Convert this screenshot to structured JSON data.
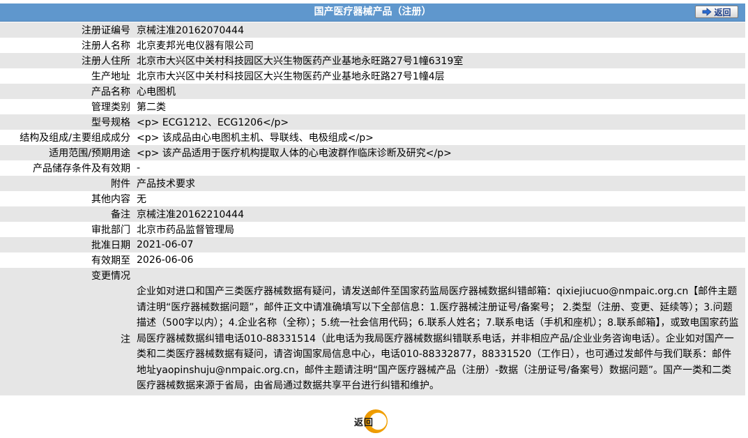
{
  "header": {
    "title": "国产医疗器械产品（注册）",
    "back_label": "返回"
  },
  "fields": [
    {
      "label": "注册证编号",
      "value": "京械注准20162070444"
    },
    {
      "label": "注册人名称",
      "value": "北京麦邦光电仪器有限公司"
    },
    {
      "label": "注册人住所",
      "value": "北京市大兴区中关村科技园区大兴生物医药产业基地永旺路27号1幢6319室"
    },
    {
      "label": "生产地址",
      "value": "北京市大兴区中关村科技园区大兴生物医药产业基地永旺路27号1幢4层"
    },
    {
      "label": "产品名称",
      "value": "心电图机"
    },
    {
      "label": "管理类别",
      "value": "第二类"
    },
    {
      "label": "型号规格",
      "value": "<p> ECG1212、ECG1206</p>"
    },
    {
      "label": "结构及组成/主要组成成分",
      "value": "<p> 该成品由心电图机主机、导联线、电极组成</p>"
    },
    {
      "label": "适用范围/预期用途",
      "value": "<p> 该产品适用于医疗机构提取人体的心电波群作临床诊断及研究</p>"
    },
    {
      "label": "产品储存条件及有效期",
      "value": "-"
    },
    {
      "label": "附件",
      "value": "产品技术要求"
    },
    {
      "label": "其他内容",
      "value": "无"
    },
    {
      "label": "备注",
      "value": "京械注准20162210444"
    },
    {
      "label": "审批部门",
      "value": "北京市药品监督管理局"
    },
    {
      "label": "批准日期",
      "value": "2021-06-07"
    },
    {
      "label": "有效期至",
      "value": "2026-06-06"
    }
  ],
  "change": {
    "label": "变更情况",
    "value": ""
  },
  "note": {
    "label": "注",
    "text": "企业如对进口和国产三类医疗器械数据有疑问，请发送邮件至国家药监局医疗器械数据纠错邮箱：qixiejiucuo@nmpaic.org.cn【邮件主题请注明“医疗器械数据问题”，邮件正文中请准确填写以下全部信息：1.医疗器械注册证号/备案号； 2.类型（注册、变更、延续等）；3.问题描述（500字以内）；4.企业名称（全称）；5.统一社会信用代码；6.联系人姓名；7.联系电话（手机和座机）；8.联系邮箱】，或致电国家药监局医疗器械数据纠错电话010-88331514（此电话为我局医疗器械数据纠错联系电话，并非相应产品/企业业务咨询电话）。企业如对国产一类和二类医疗器械数据有疑问，请咨询国家局信息中心，电话010-88332877，88331520（工作日），也可通过发邮件与我们联系：邮件地址yaopinshuju@nmpaic.org.cn，邮件主题请注明“国产医疗器械产品（注册）-数据（注册证号/备案号）数据问题”。国产一类和二类医疗器械数据来源于省局，由省局通过数据共享平台进行纠错和维护。"
  },
  "footer": {
    "back_label": "返回"
  },
  "colors": {
    "header_bg": "#5f97cd",
    "row_alt": "#e6e6e6",
    "button_ring": "#f2a100"
  }
}
